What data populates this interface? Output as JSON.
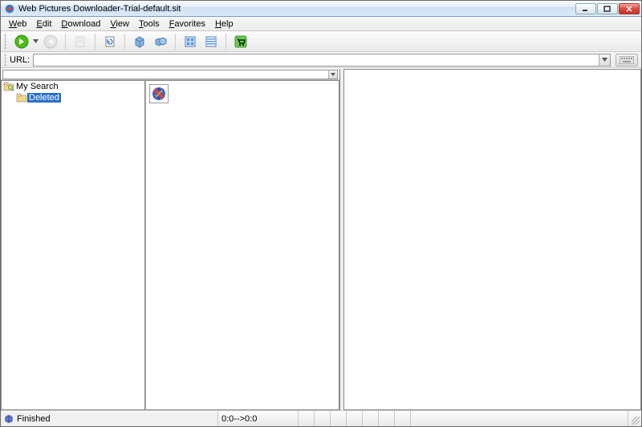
{
  "window": {
    "title": "Web Pictures Downloader-Trial-default.sit"
  },
  "menu": {
    "web": "Web",
    "edit": "Edit",
    "download": "Download",
    "view": "View",
    "tools": "Tools",
    "favorites": "Favorites",
    "help": "Help"
  },
  "urlbar": {
    "label": "URL:",
    "value": ""
  },
  "tree": {
    "root": "My Search",
    "selected_child": "Deleted"
  },
  "status": {
    "text": "Finished",
    "time": "0:0-->0:0"
  },
  "icons": {
    "go": "go-icon",
    "back": "back-icon",
    "stop": "stop-icon",
    "refresh": "refresh-icon",
    "cube": "cube-icon",
    "cube2": "cube2-icon",
    "grid": "grid-icon",
    "table": "table-icon",
    "cart": "cart-icon"
  }
}
